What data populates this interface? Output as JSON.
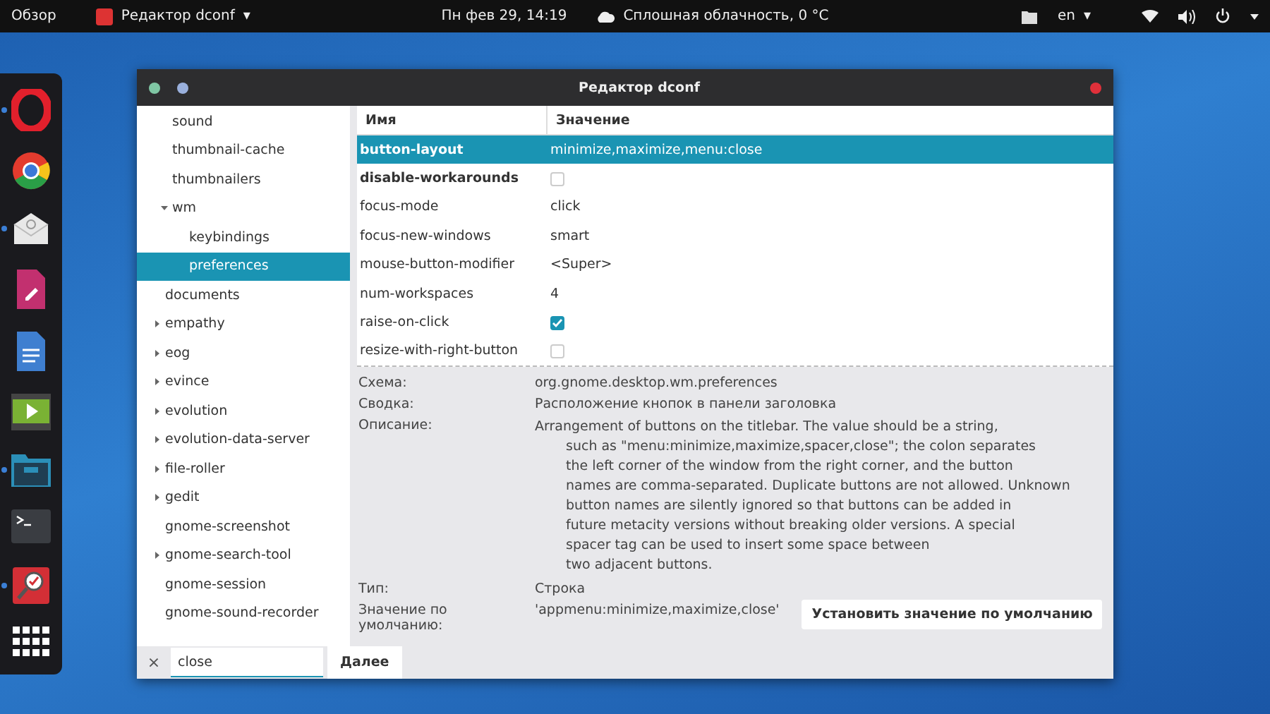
{
  "top_bar": {
    "activities": "Обзор",
    "app_menu": "Редактор dconf",
    "app_menu_arrow": "▾",
    "clock": "Пн фев 29, 14:19",
    "weather": "Сплошная облачность, 0 °C",
    "language": "en",
    "language_arrow": "▾"
  },
  "dock": {
    "apps": [
      {
        "kind": "opera",
        "running": true
      },
      {
        "kind": "chrome",
        "running": false
      },
      {
        "kind": "mail",
        "running": true
      },
      {
        "kind": "draw",
        "running": false
      },
      {
        "kind": "writer",
        "running": false
      },
      {
        "kind": "video",
        "running": false
      },
      {
        "kind": "files",
        "running": true
      },
      {
        "kind": "terminal",
        "running": false
      },
      {
        "kind": "search",
        "running": true
      },
      {
        "kind": "grid",
        "running": false
      }
    ]
  },
  "window": {
    "title": "Редактор dconf",
    "tree": {
      "partial_branch": [
        {
          "label": "sound",
          "expandable": false,
          "selected": false
        },
        {
          "label": "thumbnail-cache",
          "expandable": false,
          "selected": false
        },
        {
          "label": "thumbnailers",
          "expandable": false,
          "selected": false
        },
        {
          "label": "wm",
          "expandable": true,
          "expanded": true,
          "selected": false,
          "children": [
            {
              "label": "keybindings",
              "expandable": false,
              "selected": false
            },
            {
              "label": "preferences",
              "expandable": false,
              "selected": true
            }
          ]
        }
      ],
      "items": [
        {
          "label": "documents",
          "expandable": false,
          "selected": false
        },
        {
          "label": "empathy",
          "expandable": true,
          "expanded": false,
          "selected": false
        },
        {
          "label": "eog",
          "expandable": true,
          "expanded": false,
          "selected": false
        },
        {
          "label": "evince",
          "expandable": true,
          "expanded": false,
          "selected": false
        },
        {
          "label": "evolution",
          "expandable": true,
          "expanded": false,
          "selected": false
        },
        {
          "label": "evolution-data-server",
          "expandable": true,
          "expanded": false,
          "selected": false
        },
        {
          "label": "file-roller",
          "expandable": true,
          "expanded": false,
          "selected": false
        },
        {
          "label": "gedit",
          "expandable": true,
          "expanded": false,
          "selected": false
        },
        {
          "label": "gnome-screenshot",
          "expandable": false,
          "selected": false
        },
        {
          "label": "gnome-search-tool",
          "expandable": true,
          "expanded": false,
          "selected": false
        },
        {
          "label": "gnome-session",
          "expandable": false,
          "selected": false
        },
        {
          "label": "gnome-sound-recorder",
          "expandable": false,
          "selected": false
        }
      ]
    },
    "table": {
      "columns": [
        "Имя",
        "Значение"
      ],
      "rows": [
        {
          "name": "button-layout",
          "kind": "text",
          "value": "minimize,maximize,menu:close",
          "modified": true,
          "selected": true
        },
        {
          "name": "disable-workarounds",
          "kind": "checkbox",
          "checked": false,
          "modified": true,
          "selected": false
        },
        {
          "name": "focus-mode",
          "kind": "text",
          "value": "click",
          "modified": false,
          "selected": false
        },
        {
          "name": "focus-new-windows",
          "kind": "text",
          "value": "smart",
          "modified": false,
          "selected": false
        },
        {
          "name": "mouse-button-modifier",
          "kind": "text",
          "value": "<Super>",
          "modified": false,
          "selected": false
        },
        {
          "name": "num-workspaces",
          "kind": "text",
          "value": "4",
          "modified": false,
          "selected": false
        },
        {
          "name": "raise-on-click",
          "kind": "checkbox",
          "checked": true,
          "modified": false,
          "selected": false
        },
        {
          "name": "resize-with-right-button",
          "kind": "checkbox",
          "checked": false,
          "modified": false,
          "selected": false
        }
      ]
    },
    "details": {
      "schema_label": "Схема:",
      "schema": "org.gnome.desktop.wm.preferences",
      "summary_label": "Сводка:",
      "summary": "Расположение кнопок в панели заголовка",
      "description_label": "Описание:",
      "description_lines": [
        "Arrangement of buttons on the titlebar. The value should be a string,",
        "such as  \"menu:minimize,maximize,spacer,close\"; the colon separates",
        "the  left corner of the window from the right corner, and  the button",
        "names are comma-separated. Duplicate buttons are not allowed. Unknown",
        "button names are silently ignored so that buttons can be added in",
        "future metacity versions  without breaking older versions. A special",
        "spacer tag can be used to insert some space between",
        "two adjacent buttons."
      ],
      "type_label": "Тип:",
      "type": "Строка",
      "default_label": "Значение по умолчанию:",
      "default": "'appmenu:minimize,maximize,close'",
      "reset_button": "Установить значение по умолчанию"
    },
    "search_bar": {
      "close": "×",
      "value": "close",
      "next_button": "Далее"
    }
  }
}
